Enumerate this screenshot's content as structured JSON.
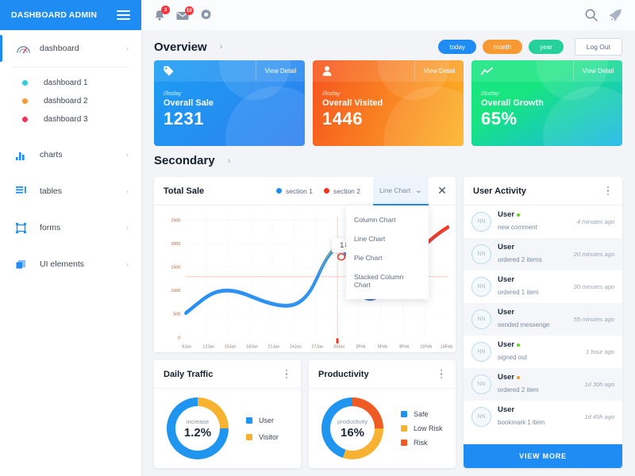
{
  "sidebar": {
    "brand": "DASHBOARD ADMIN",
    "menu_icon": "hamburger-icon",
    "items": [
      {
        "label": "dashboard",
        "icon": "gauge-icon",
        "chevron": "›",
        "active": true
      },
      {
        "label": "charts",
        "icon": "bar-chart-icon",
        "chevron": "›",
        "active": false
      },
      {
        "label": "tables",
        "icon": "table-list-icon",
        "chevron": "›",
        "active": false
      },
      {
        "label": "forms",
        "icon": "form-icon",
        "chevron": "›",
        "active": false
      },
      {
        "label": "UI elements",
        "icon": "layers-icon",
        "chevron": "›",
        "active": false
      }
    ],
    "sub_items": [
      {
        "label": "dashboard 1",
        "color": "#32cdd6"
      },
      {
        "label": "dashboard 2",
        "color": "#f79932"
      },
      {
        "label": "dashboard 3",
        "color": "#f5325b"
      }
    ]
  },
  "topbar": {
    "bell_badge": "3",
    "mail_badge": "10",
    "icons": [
      "bell-icon",
      "mail-icon",
      "gear-icon",
      "search-icon",
      "rocket-icon"
    ]
  },
  "overview": {
    "title": "Overview",
    "chevron": "›",
    "filters": [
      {
        "label": "today",
        "color": "#1f8cf4"
      },
      {
        "label": "month",
        "color": "#f79932"
      },
      {
        "label": "year",
        "color": "#25d09a"
      }
    ],
    "logout_label": "Log Out",
    "cards": [
      {
        "icon": "tag-icon",
        "view_detail": "View Detail",
        "sub": "//today",
        "title": "Overall Sale",
        "value": "1231",
        "from": "#1b9ef2",
        "to": "#2e7ff0"
      },
      {
        "icon": "user-icon",
        "view_detail": "View Detail",
        "sub": "//today",
        "title": "Overall Visited",
        "value": "1446",
        "from": "#f6531f",
        "to": "#fcb424"
      },
      {
        "icon": "trend-icon",
        "view_detail": "View Detail",
        "sub": "//today",
        "title": "Overall Growth",
        "value": "65%",
        "from": "#18e57f",
        "to": "#19b6e8"
      }
    ]
  },
  "secondary": {
    "title": "Secondary",
    "chevron": "›"
  },
  "total_sale": {
    "title": "Total Sale",
    "legend": [
      {
        "label": "section 1",
        "color": "#1f8cf4"
      },
      {
        "label": "section 2",
        "color": "#f4331f"
      }
    ],
    "select_value": "Line Chart",
    "select_caret": "⌄",
    "close_label": "✕",
    "dropdown_options": [
      "Column Chart",
      "Line Chart",
      "Pie Chart",
      "Stacked Column Chart"
    ],
    "tooltip_value": "1830"
  },
  "chart_data": {
    "type": "line",
    "title": "Total Sale",
    "xlabel": "",
    "ylabel": "",
    "x": [
      "9Jan",
      "12Jan",
      "15Jan",
      "18Jan",
      "21Jan",
      "24Jan",
      "27Jan",
      "30Jan",
      "2Feb",
      "5Feb",
      "8Feb",
      "11Feb",
      "14Feb"
    ],
    "yticks": [
      "0",
      "500",
      "1000",
      "1500",
      "2000",
      "2500"
    ],
    "ylim": [
      0,
      2500
    ],
    "grid": true,
    "legend_position": "top-right",
    "annotation": {
      "label": "1830",
      "x": "27Jan",
      "y": 1830
    },
    "series": [
      {
        "name": "section 1",
        "color": "#1f8cf4",
        "values": [
          500,
          980,
          1150,
          1120,
          980,
          950,
          2050,
          1830,
          1250,
          1400,
          1950,
          2300,
          2500
        ]
      },
      {
        "name": "section 2",
        "color": "#f4331f",
        "values": [
          510,
          990,
          1160,
          1130,
          990,
          960,
          2060,
          1830,
          1260,
          1410,
          1960,
          2310,
          2500
        ]
      }
    ]
  },
  "user_activity": {
    "title": "User Activity",
    "kebab": "more-options",
    "view_more": "VIEW MORE",
    "avatar_initials": "NN",
    "rows": [
      {
        "name": "User",
        "desc": "new comment",
        "time": "4 minutes ago",
        "status": "#5fd915"
      },
      {
        "name": "User",
        "desc": "ordered 2 items",
        "time": "20 minutes ago",
        "status": ""
      },
      {
        "name": "User",
        "desc": "ordered 1 item",
        "time": "30 minutes ago",
        "status": ""
      },
      {
        "name": "User",
        "desc": "sended messenge",
        "time": "55 minutes ago",
        "status": ""
      },
      {
        "name": "User",
        "desc": "signed out",
        "time": "1 hour ago",
        "status": "#5fd915"
      },
      {
        "name": "User",
        "desc": "ordered 2 item",
        "time": "1d 30h ago",
        "status": "#f79932"
      },
      {
        "name": "User",
        "desc": "bookmark 1 item",
        "time": "1d 45h  ago",
        "status": ""
      }
    ]
  },
  "daily_traffic": {
    "title": "Daily Traffic",
    "caption": "increase",
    "value": "1.2%",
    "chart_data": {
      "type": "pie",
      "title": "Daily Traffic",
      "labels": [
        "User",
        "Visitor"
      ],
      "values": [
        75,
        25
      ],
      "colors": [
        "#1f95f0",
        "#f7b231"
      ]
    }
  },
  "productivity": {
    "title": "Productivity",
    "caption": "productivity",
    "value": "16%",
    "chart_data": {
      "type": "pie",
      "title": "Productivity",
      "labels": [
        "Safe",
        "Low Risk",
        "Risk"
      ],
      "values": [
        45,
        30,
        25
      ],
      "colors": [
        "#1f95f0",
        "#f7b231",
        "#f05a23"
      ]
    }
  }
}
